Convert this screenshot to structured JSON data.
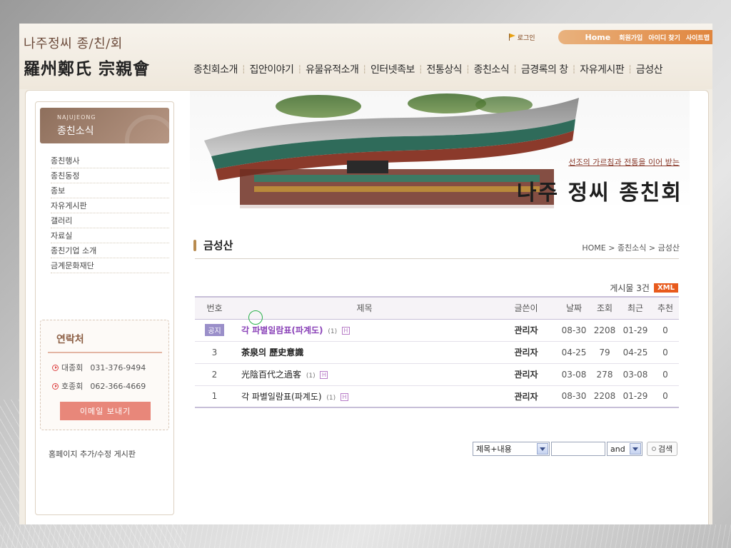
{
  "header": {
    "logo_kr": "나주정씨 종/친/회",
    "logo_cn": "羅州鄭氏 宗親會",
    "login": "로그인",
    "top_links": [
      "Home",
      "회원가입",
      "아이디 찾기",
      "사이트맵"
    ],
    "gnb": [
      "종친회소개",
      "집안이야기",
      "유물유적소개",
      "인터넷족보",
      "전통상식",
      "종친소식",
      "금경록의 창",
      "자유게시판",
      "금성산"
    ]
  },
  "sidebar": {
    "en_title": "NAJUJEONG",
    "title": "종친소식",
    "items": [
      "종친행사",
      "종친동정",
      "종보",
      "자유게시판",
      "갤러리",
      "자료실",
      "종친기업 소개",
      "금계문화재단"
    ],
    "contact": {
      "title": "연락처",
      "rows": [
        {
          "label": "대종회",
          "phone": "031-376-9494"
        },
        {
          "label": "호종회",
          "phone": "062-366-4669"
        }
      ],
      "email_label": "이메일 보내기"
    },
    "note": "홈페이지 추가/수정 게시판"
  },
  "banner": {
    "slogan": "선조의 가르침과 전통을 이어 받는",
    "brand": "나주 정씨 종친회"
  },
  "board": {
    "title": "금성산",
    "breadcrumb": "HOME > 종친소식 > 금성산",
    "post_count": "게시물 3건",
    "xml": "XML",
    "columns": [
      "번호",
      "제목",
      "글쓴이",
      "날짜",
      "조회",
      "최근",
      "추천"
    ],
    "rows": [
      {
        "num": "공지",
        "subject": "각 파별일람표(파계도)",
        "count": "(1)",
        "author": "관리자",
        "date": "08-30",
        "views": "2208",
        "recent": "01-29",
        "rec": "0"
      },
      {
        "num": "3",
        "subject": "茶泉의 歷史意識",
        "count": "",
        "author": "관리자",
        "date": "04-25",
        "views": "79",
        "recent": "04-25",
        "rec": "0"
      },
      {
        "num": "2",
        "subject": "光陰百代之過客",
        "count": "(1)",
        "author": "관리자",
        "date": "03-08",
        "views": "278",
        "recent": "03-08",
        "rec": "0"
      },
      {
        "num": "1",
        "subject": "각 파별일람표(파계도)",
        "count": "(1)",
        "author": "관리자",
        "date": "08-30",
        "views": "2208",
        "recent": "01-29",
        "rec": "0"
      }
    ],
    "h_icon": "H"
  },
  "search": {
    "field_select": "제목+내용",
    "op_select": "and",
    "button": "검색"
  }
}
